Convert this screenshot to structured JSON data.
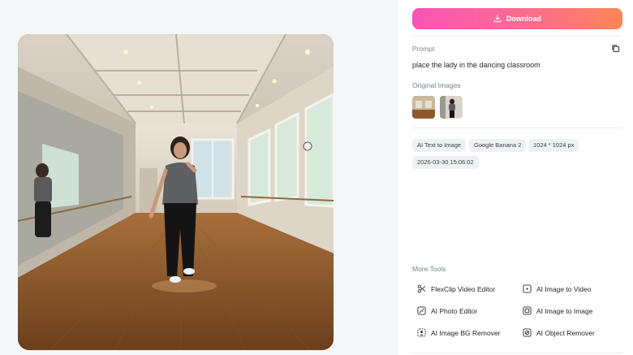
{
  "download": {
    "label": "Download"
  },
  "prompt": {
    "label": "Prompt",
    "text": "place the lady in the dancing classroom"
  },
  "original_images": {
    "label": "Original Images",
    "items": [
      {
        "alt": "dance studio thumbnail"
      },
      {
        "alt": "woman thumbnail"
      }
    ]
  },
  "tags": [
    "AI Text to Image",
    "Google Banana 2",
    "1024 * 1024 px",
    "2026-03-30 15:06:02"
  ],
  "more_tools": {
    "label": "More Tools",
    "items": [
      {
        "label": "FlexClip Video Editor",
        "icon": "scissors-icon"
      },
      {
        "label": "AI Image to Video",
        "icon": "image-video-icon"
      },
      {
        "label": "AI Photo Editor",
        "icon": "photo-edit-icon"
      },
      {
        "label": "AI Image to Image",
        "icon": "image-to-image-icon"
      },
      {
        "label": "AI Image BG Remover",
        "icon": "bg-remover-icon"
      },
      {
        "label": "AI Object Remover",
        "icon": "object-remover-icon"
      }
    ]
  },
  "colors": {
    "button_gradient_start": "#f954b5",
    "button_gradient_end": "#fc8558",
    "tag_bg": "#f0f1f4",
    "label_gray": "#7a808a"
  }
}
